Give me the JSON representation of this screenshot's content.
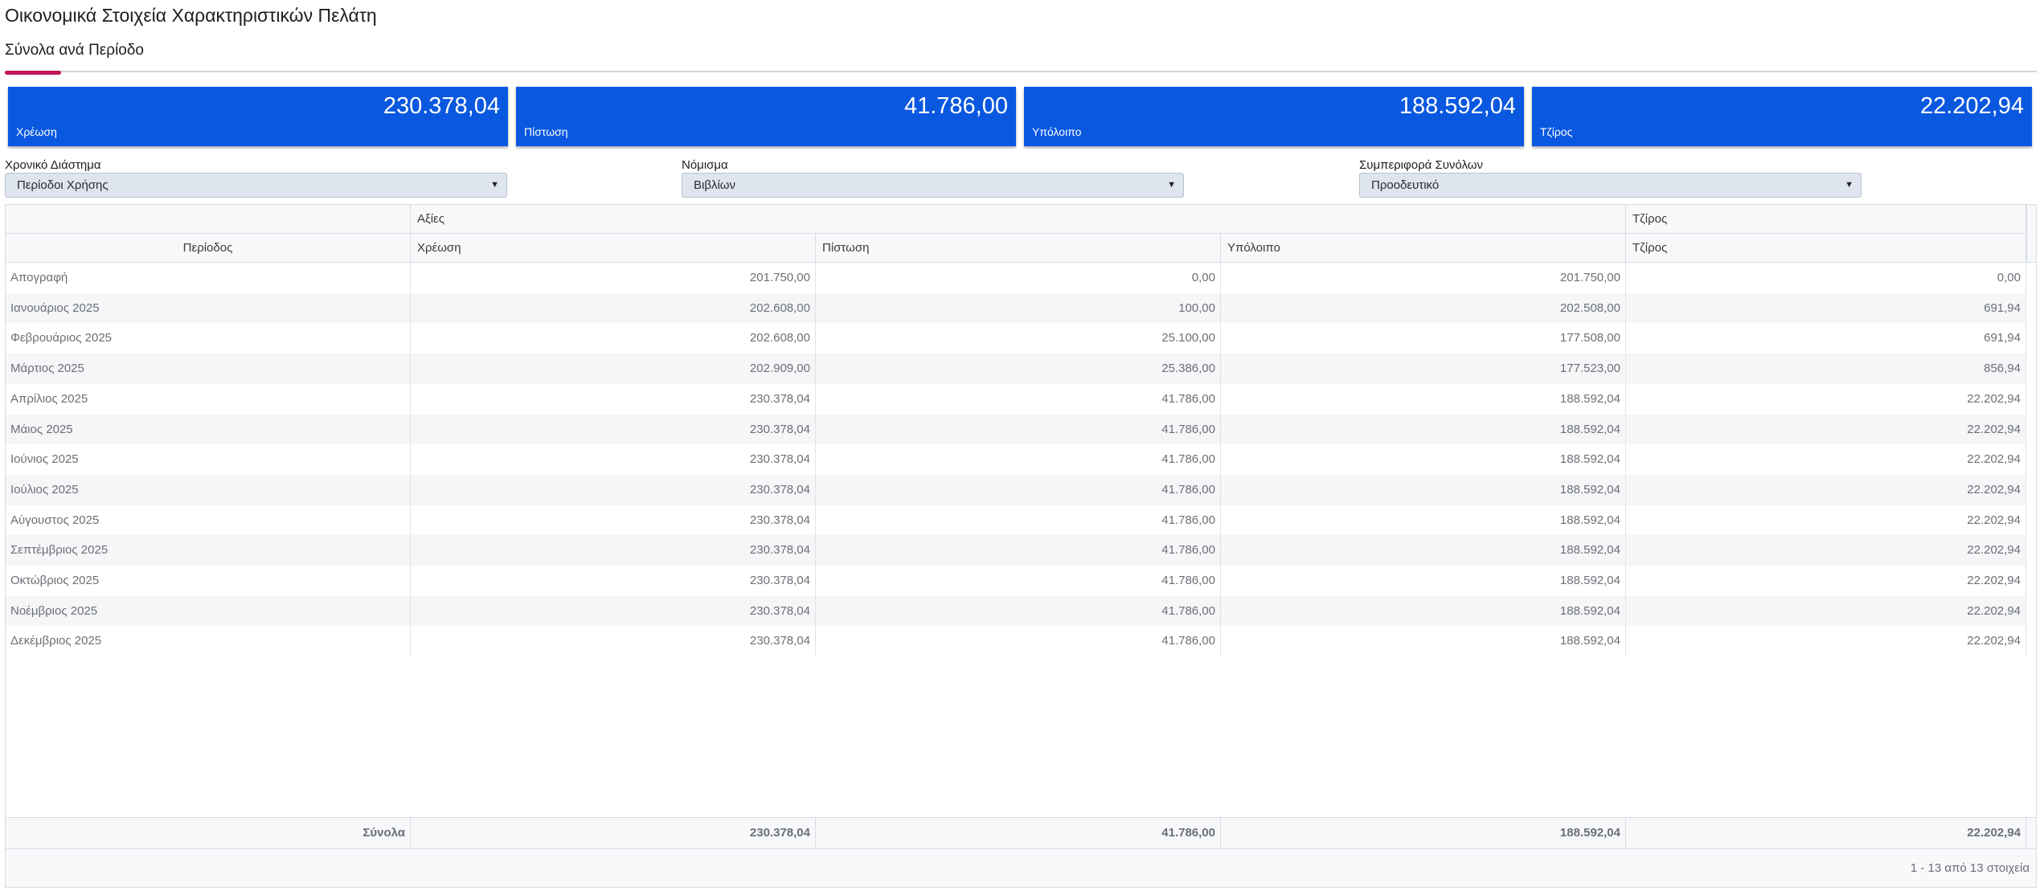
{
  "page": {
    "title": "Οικονομικά Στοιχεία Χαρακτηριστικών Πελάτη",
    "tab_label": "Σύνολα ανά Περίοδο"
  },
  "colors": {
    "accent": "#c2185b",
    "card_bg": "#0a58e0"
  },
  "cards": [
    {
      "value": "230.378,04",
      "label": "Χρέωση"
    },
    {
      "value": "41.786,00",
      "label": "Πίστωση"
    },
    {
      "value": "188.592,04",
      "label": "Υπόλοιπο"
    },
    {
      "value": "22.202,94",
      "label": "Τζίρος"
    }
  ],
  "filters": [
    {
      "label": "Χρονικό Διάστημα",
      "value": "Περίοδοι Χρήσης",
      "icon": "caret-down-icon"
    },
    {
      "label": "Νόμισμα",
      "value": "Βιβλίων",
      "icon": "caret-down-icon"
    },
    {
      "label": "Συμπεριφορά Συνόλων",
      "value": "Προοδευτικό",
      "icon": "caret-down-icon"
    }
  ],
  "grid": {
    "group_headers": {
      "values": "Αξίες",
      "turnover": "Τζίρος"
    },
    "columns": [
      "Περίοδος",
      "Χρέωση",
      "Πίστωση",
      "Υπόλοιπο",
      "Τζίρος"
    ],
    "rows": [
      [
        "Απογραφή",
        "201.750,00",
        "0,00",
        "201.750,00",
        "0,00"
      ],
      [
        "Ιανουάριος 2025",
        "202.608,00",
        "100,00",
        "202.508,00",
        "691,94"
      ],
      [
        "Φεβρουάριος 2025",
        "202.608,00",
        "25.100,00",
        "177.508,00",
        "691,94"
      ],
      [
        "Μάρτιος 2025",
        "202.909,00",
        "25.386,00",
        "177.523,00",
        "856,94"
      ],
      [
        "Απρίλιος 2025",
        "230.378,04",
        "41.786,00",
        "188.592,04",
        "22.202,94"
      ],
      [
        "Μάιος 2025",
        "230.378,04",
        "41.786,00",
        "188.592,04",
        "22.202,94"
      ],
      [
        "Ιούνιος 2025",
        "230.378,04",
        "41.786,00",
        "188.592,04",
        "22.202,94"
      ],
      [
        "Ιούλιος 2025",
        "230.378,04",
        "41.786,00",
        "188.592,04",
        "22.202,94"
      ],
      [
        "Αύγουστος 2025",
        "230.378,04",
        "41.786,00",
        "188.592,04",
        "22.202,94"
      ],
      [
        "Σεπτέμβριος 2025",
        "230.378,04",
        "41.786,00",
        "188.592,04",
        "22.202,94"
      ],
      [
        "Οκτώβριος 2025",
        "230.378,04",
        "41.786,00",
        "188.592,04",
        "22.202,94"
      ],
      [
        "Νοέμβριος 2025",
        "230.378,04",
        "41.786,00",
        "188.592,04",
        "22.202,94"
      ],
      [
        "Δεκέμβριος 2025",
        "230.378,04",
        "41.786,00",
        "188.592,04",
        "22.202,94"
      ]
    ],
    "footer": {
      "label": "Σύνολα",
      "debit": "230.378,04",
      "credit": "41.786,00",
      "balance": "188.592,04",
      "turnover": "22.202,94"
    },
    "pager_info": "1 - 13 από 13 στοιχεία"
  }
}
